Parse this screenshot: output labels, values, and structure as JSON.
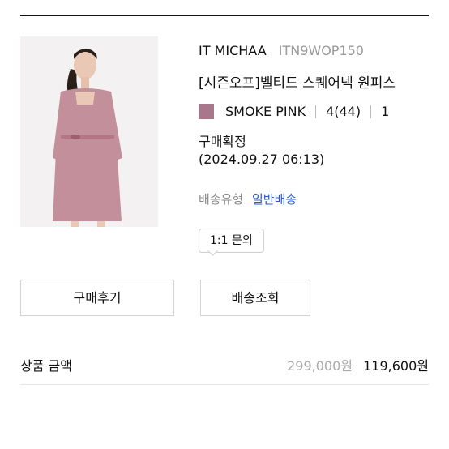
{
  "product": {
    "brand": "IT MICHAA",
    "code": "ITN9WOP150",
    "name": "[시즌오프]벨티드 스퀘어넥 원피스",
    "color_name": "SMOKE PINK",
    "color_swatch": "#a8788a",
    "size": "4(44)",
    "quantity": "1"
  },
  "order": {
    "status": "구매확정",
    "datetime": "(2024.09.27 06:13)",
    "shipping_label": "배송유형",
    "shipping_value": "일반배송",
    "inquiry_label": "1:1 문의"
  },
  "actions": {
    "review_label": "구매후기",
    "track_label": "배송조회"
  },
  "price": {
    "label": "상품 금액",
    "original": "299,000원",
    "final": "119,600원"
  }
}
